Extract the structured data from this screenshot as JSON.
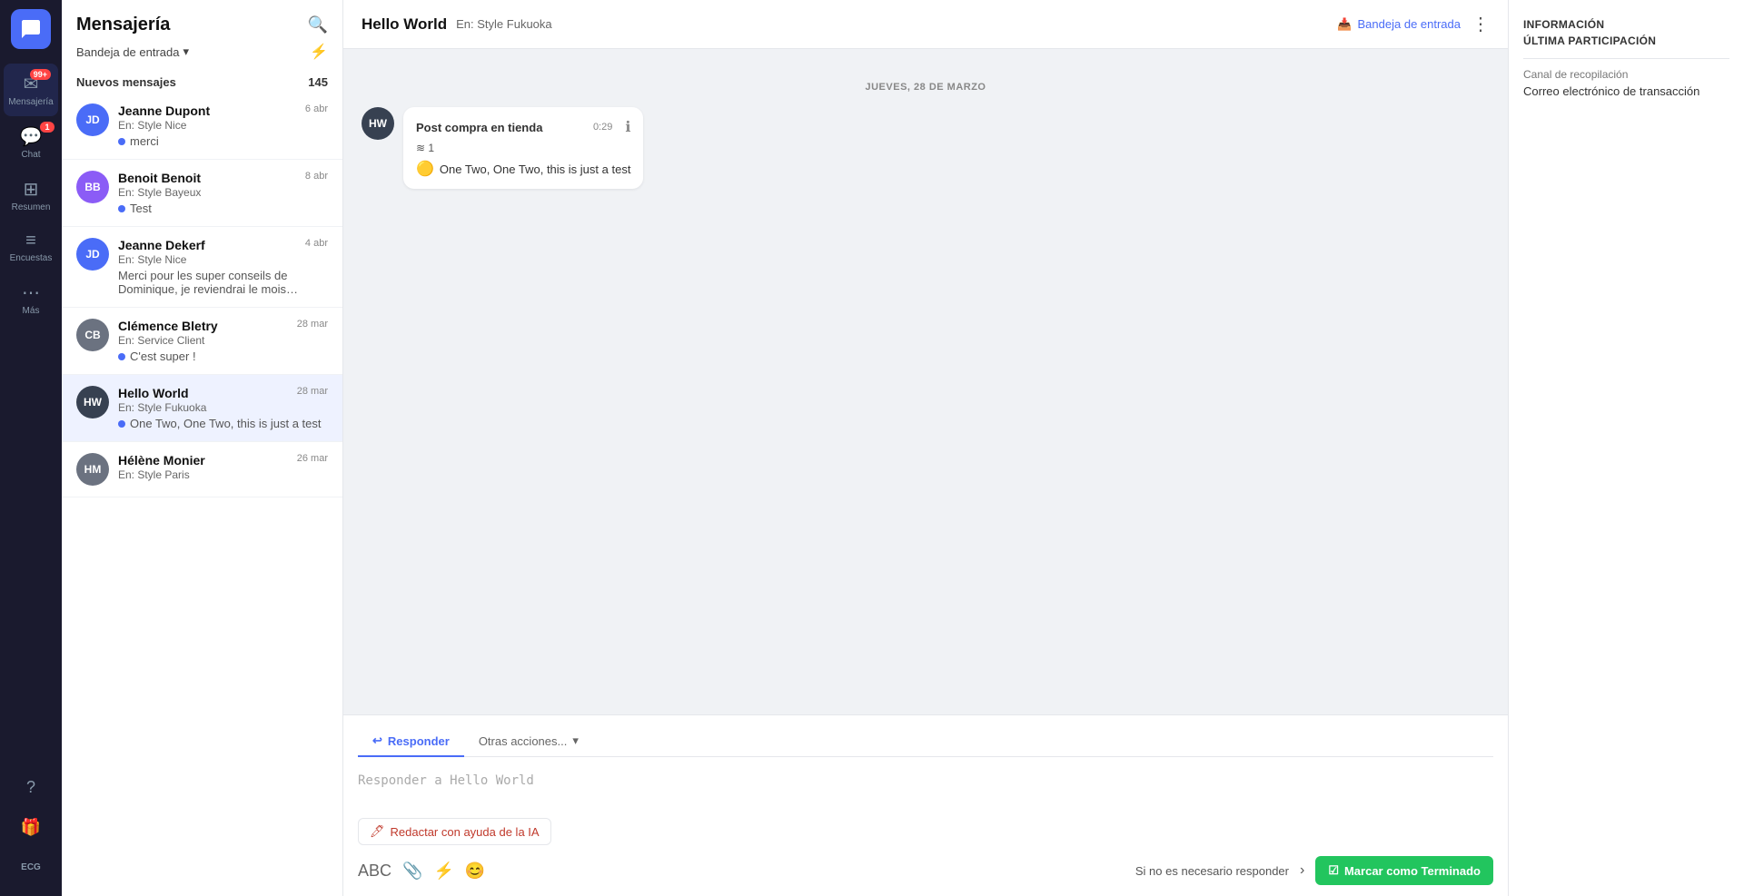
{
  "nav": {
    "logo_initials": "",
    "items": [
      {
        "id": "mensajeria",
        "label": "Mensajería",
        "icon": "✉",
        "badge": "99+",
        "active": true
      },
      {
        "id": "chat",
        "label": "Chat",
        "icon": "💬",
        "badge": "1",
        "active": false
      },
      {
        "id": "resumen",
        "label": "Resumen",
        "icon": "⊞",
        "active": false
      },
      {
        "id": "encuestas",
        "label": "Encuestas",
        "icon": "≡",
        "active": false
      },
      {
        "id": "mas",
        "label": "Más",
        "icon": "⋯",
        "active": false
      }
    ],
    "bottom_items": [
      {
        "id": "help",
        "icon": "?"
      },
      {
        "id": "gift",
        "icon": "🎁"
      },
      {
        "id": "ecg",
        "label": "ECG"
      }
    ]
  },
  "sidebar": {
    "title": "Mensajería",
    "filter_label": "Bandeja de entrada",
    "filter_chevron": "▾",
    "new_messages_label": "Nuevos mensajes",
    "new_messages_count": "145",
    "conversations": [
      {
        "id": "jeanne-dupont",
        "initials": "JD",
        "avatar_class": "avatar-jd",
        "name": "Jeanne Dupont",
        "date": "6 abr",
        "source": "En: Style Nice",
        "preview": "merci",
        "has_dot": true
      },
      {
        "id": "benoit-benoit",
        "initials": "BB",
        "avatar_class": "avatar-bb",
        "name": "Benoit Benoit",
        "date": "8 abr",
        "source": "En: Style Bayeux",
        "preview": "Test",
        "has_dot": true
      },
      {
        "id": "jeanne-dekerf",
        "initials": "JD",
        "avatar_class": "avatar-jd",
        "name": "Jeanne Dekerf",
        "date": "4 abr",
        "source": "En: Style Nice",
        "preview": "Merci pour les super conseils de Dominique, je reviendrai le mois prochain...",
        "has_dot": true
      },
      {
        "id": "clemence-bletry",
        "initials": "CB",
        "avatar_class": "avatar-cb",
        "name": "Clémence Bletry",
        "date": "28 mar",
        "source": "En: Service Client",
        "preview": "C'est super !",
        "has_dot": true
      },
      {
        "id": "hello-world",
        "initials": "HW",
        "avatar_class": "avatar-hw",
        "name": "Hello World",
        "date": "28 mar",
        "source": "En: Style Fukuoka",
        "preview": "One Two, One Two, this is just a test",
        "has_dot": true,
        "active": true
      },
      {
        "id": "helene-monier",
        "initials": "HM",
        "avatar_class": "avatar-hm",
        "name": "Hélène Monier",
        "date": "26 mar",
        "source": "En: Style Paris",
        "preview": "",
        "has_dot": false
      }
    ]
  },
  "chat": {
    "title": "Hello World",
    "subtitle": "En: Style Fukuoka",
    "inbox_label": "Bandeja de entrada",
    "date_separator": "JUEVES, 28 DE MARZO",
    "message": {
      "sender_initials": "HW",
      "type_label": "Post compra en tienda",
      "time": "0:29",
      "stack_count": "1",
      "content": "One Two, One Two, this is just a test",
      "emoji": "🟡"
    }
  },
  "reply": {
    "tab_reply": "Responder",
    "tab_other": "Otras acciones...",
    "placeholder": "Responder a Hello World",
    "ai_btn_label": "Redactar con ayuda de la IA",
    "no_reply_text": "Si no es necesario responder",
    "mark_done_label": "Marcar como Terminado"
  },
  "info_panel": {
    "title_line1": "INFORMACIÓN",
    "title_line2": "ÚLTIMA PARTICIPACIÓN",
    "canal_label": "Canal de recopilación",
    "canal_value": "Correo electrónico de transacción"
  }
}
